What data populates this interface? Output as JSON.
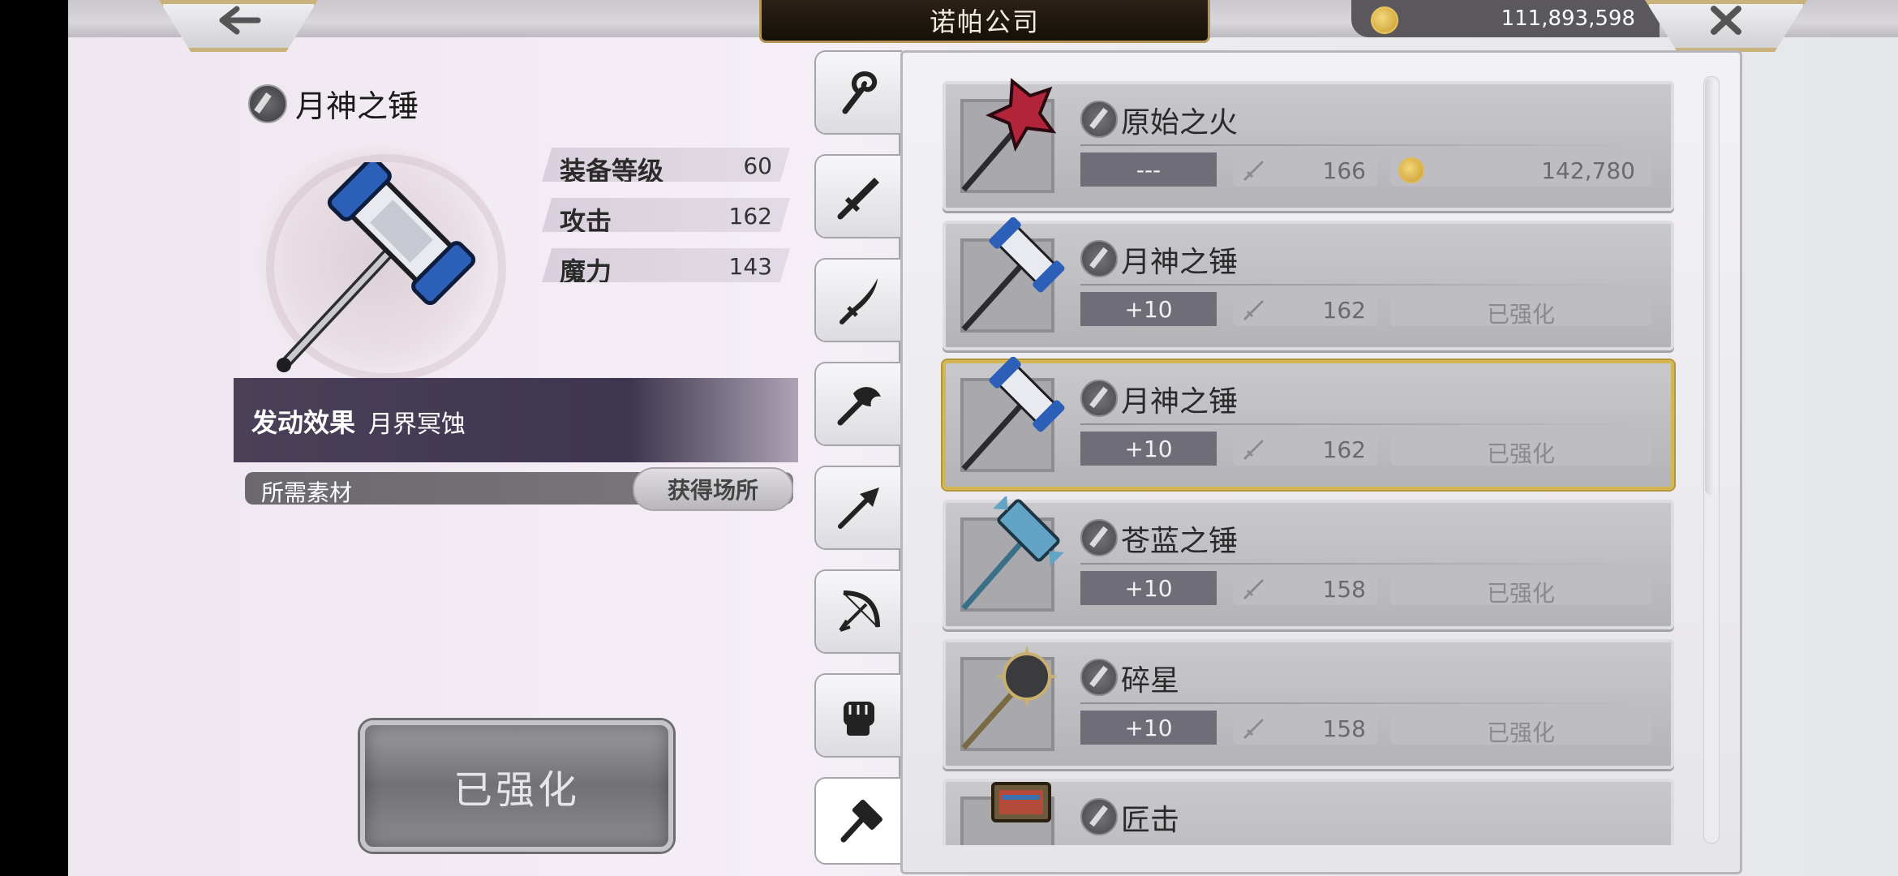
{
  "header": {
    "title": "诺帕公司",
    "currency_amount": "111,893,598",
    "back_icon": "left-arrow-icon",
    "close_icon": "close-icon"
  },
  "detail": {
    "name": "月神之锤",
    "stats": [
      {
        "label": "装备等级",
        "value": "60"
      },
      {
        "label": "攻击",
        "value": "162"
      },
      {
        "label": "魔力",
        "value": "143"
      }
    ],
    "effect_label": "发动效果",
    "effect_value": "月界冥蚀",
    "materials_label": "所需素材",
    "source_button": "获得场所",
    "status_button": "已强化"
  },
  "tabs": [
    {
      "name": "staff",
      "icon": "staff-icon"
    },
    {
      "name": "sword",
      "icon": "sword-icon"
    },
    {
      "name": "katana",
      "icon": "katana-icon"
    },
    {
      "name": "axe",
      "icon": "axe-icon"
    },
    {
      "name": "spear",
      "icon": "spear-icon"
    },
    {
      "name": "bow",
      "icon": "bow-icon"
    },
    {
      "name": "fist",
      "icon": "fist-icon"
    },
    {
      "name": "hammer",
      "icon": "hammer-icon",
      "active": true
    }
  ],
  "items": [
    {
      "name": "原始之火",
      "level": "---",
      "attack": "166",
      "price": "142,780",
      "status": ""
    },
    {
      "name": "月神之锤",
      "level": "+10",
      "attack": "162",
      "price": "",
      "status": "已强化"
    },
    {
      "name": "月神之锤",
      "level": "+10",
      "attack": "162",
      "price": "",
      "status": "已强化",
      "selected": true
    },
    {
      "name": "苍蓝之锤",
      "level": "+10",
      "attack": "158",
      "price": "",
      "status": "已强化"
    },
    {
      "name": "碎星",
      "level": "+10",
      "attack": "158",
      "price": "",
      "status": "已强化"
    },
    {
      "name": "匠击",
      "level": "",
      "attack": "",
      "price": "",
      "status": ""
    }
  ],
  "colors": {
    "selected_border": "#d3b552",
    "effect_bar": "#4a4058",
    "level_badge": "#6f6d78"
  }
}
